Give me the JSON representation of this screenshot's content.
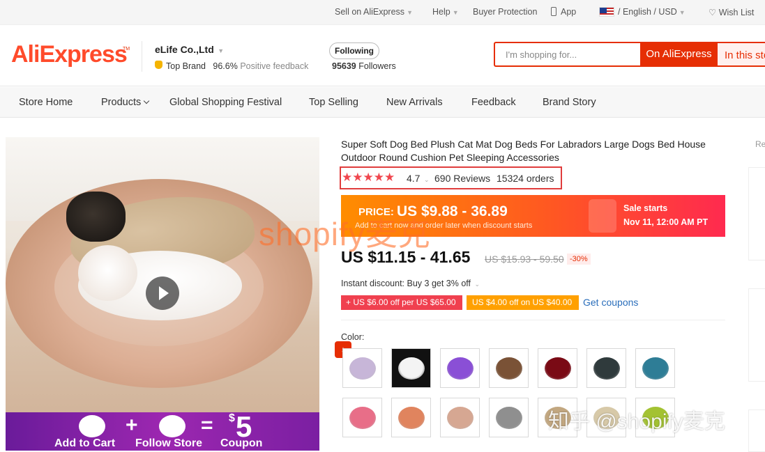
{
  "topbar": {
    "sell": "Sell on AliExpress",
    "help": "Help",
    "buyer_protection": "Buyer Protection",
    "app": "App",
    "language_currency": "/ English / USD",
    "wish_list": "Wish List"
  },
  "header": {
    "logo": "AliExpress",
    "store_name": "eLife Co.,Ltd",
    "top_brand": "Top Brand",
    "feedback_pct": "96.6%",
    "feedback_label": "Positive feedback",
    "follow_button": "Following",
    "followers_count": "95639",
    "followers_label": "Followers",
    "search_placeholder": "I'm shopping for...",
    "search_btn_ali": "On AliExpress",
    "search_btn_store": "In this store"
  },
  "nav": {
    "items": [
      "Store Home",
      "Products",
      "Global Shopping Festival",
      "Top Selling",
      "New Arrivals",
      "Feedback",
      "Brand Story"
    ]
  },
  "media": {
    "promo_texts": [
      "Add to Cart",
      "Follow Store",
      "Coupon"
    ],
    "promo_amount": "5"
  },
  "product": {
    "title": "Super Soft Dog Bed Plush Cat Mat Dog Beds For Labradors Large Dogs Bed House Outdoor Round Cushion Pet Sleeping Accessories",
    "stars": "★★★★★",
    "rating": "4.7",
    "reviews": "690 Reviews",
    "orders": "15324 orders",
    "sale_price_label": "PRICE:",
    "sale_price": "US $9.88 - 36.89",
    "sale_subtext": "Add to cart now and order later when discount starts",
    "sale_starts_label": "Sale starts",
    "sale_starts_date": "Nov 11, 12:00 AM PT",
    "price": "US $11.15 - 41.65",
    "original_price": "US $15.93 - 59.50",
    "discount": "-30%",
    "instant_discount": "Instant discount: Buy 3 get 3% off",
    "coupon_1": "+ US $6.00 off per US $65.00",
    "coupon_2": "US $4.00 off on US $40.00",
    "get_coupons": "Get coupons",
    "color_label": "Color:",
    "swatch_colors": [
      "#c7b6d8",
      "#f4f4f4",
      "#8a4fd6",
      "#7a5236",
      "#7a0a15",
      "#2f3a3c",
      "#2e7d96",
      "#e86e88",
      "#e0845e",
      "#d6a792",
      "#8f8f8f",
      "#c2a780",
      "#d7c9a8",
      "#a3c232"
    ]
  },
  "sidebar": {
    "label": "Re"
  },
  "watermarks": {
    "overlay_1": "shopify麦克",
    "overlay_2": "知乎 @shopify麦克"
  }
}
